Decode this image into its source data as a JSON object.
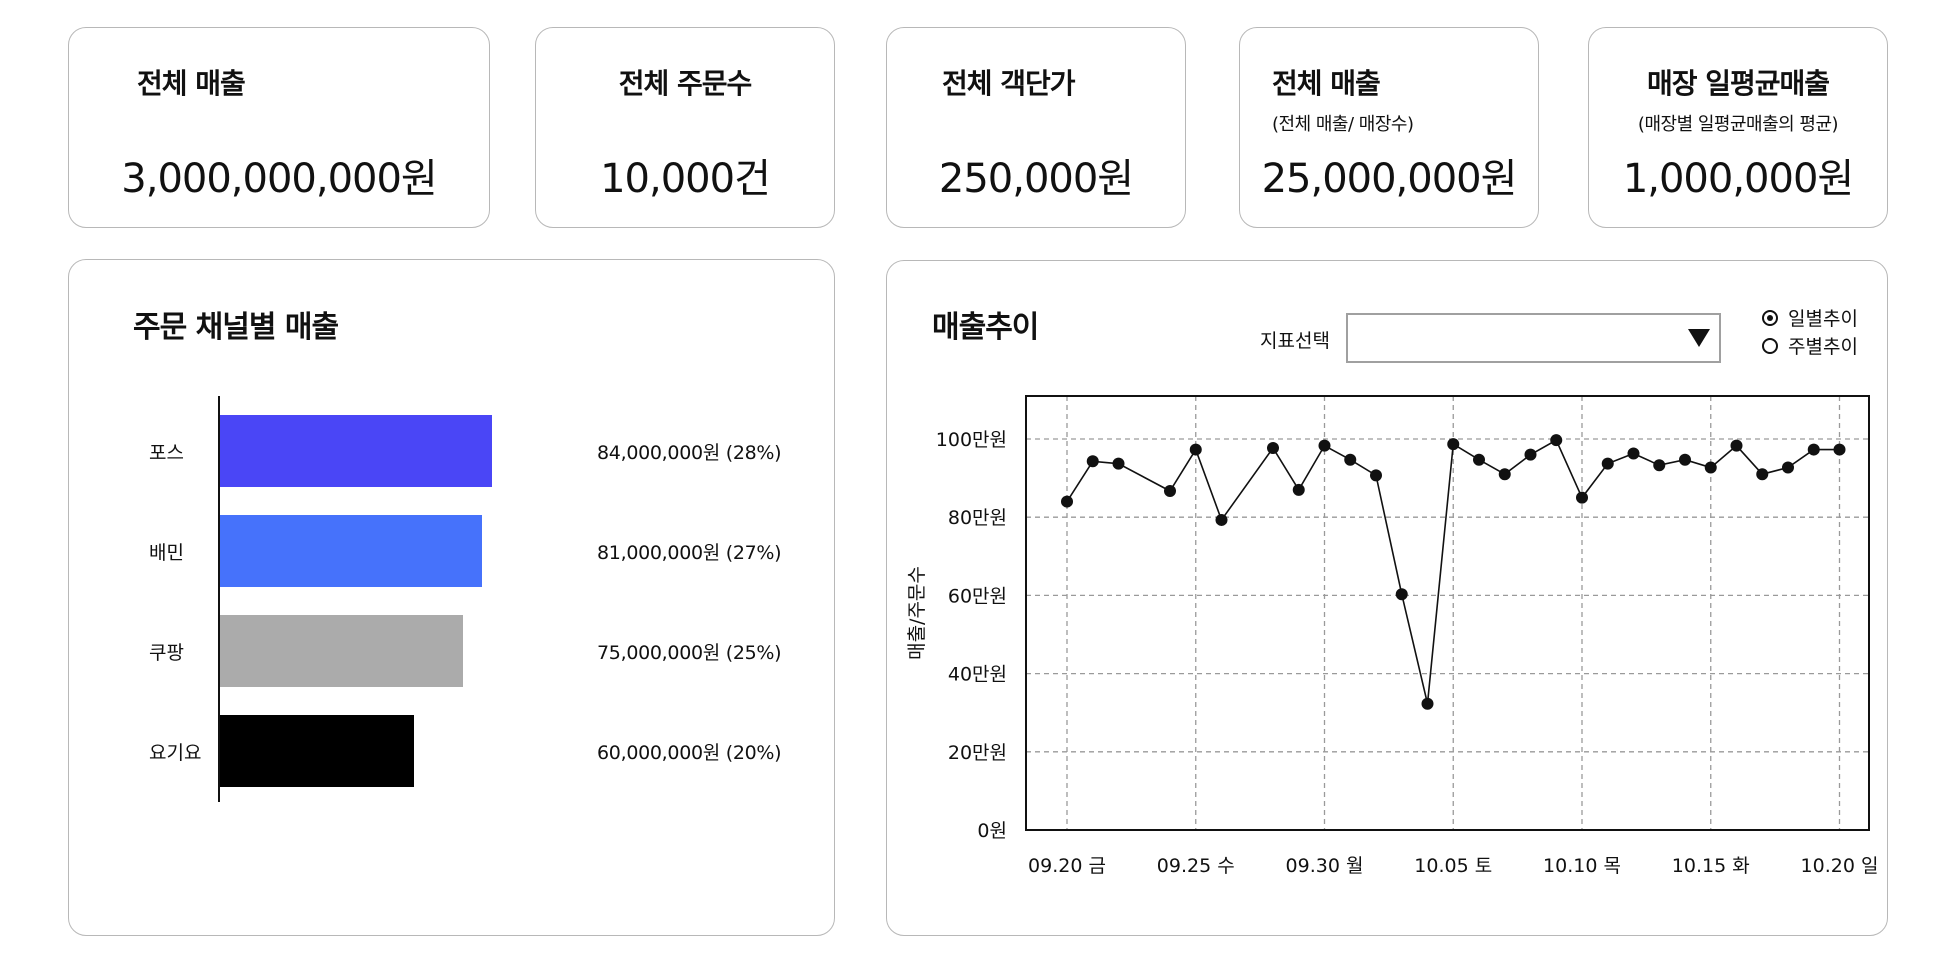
{
  "kpis": [
    {
      "title": "전체 매출",
      "subtitle": "",
      "value": "3,000,000,000원"
    },
    {
      "title": "전체 주문수",
      "subtitle": "",
      "value": "10,000건"
    },
    {
      "title": "전체 객단가",
      "subtitle": "",
      "value": "250,000원"
    },
    {
      "title": "전체 매출",
      "subtitle": "(전체 매출/ 매장수)",
      "value": "25,000,000원"
    },
    {
      "title": "매장 일평균매출",
      "subtitle": "(매장별 일평균매출의 평균)",
      "value": "1,000,000원"
    }
  ],
  "channel_panel": {
    "title": "주문 채널별 매출",
    "items": [
      {
        "label": "포스",
        "value_text": "84,000,000원 (28%)",
        "color": "#4a46f6"
      },
      {
        "label": "배민",
        "value_text": "81,000,000원 (27%)",
        "color": "#4672fb"
      },
      {
        "label": "쿠팡",
        "value_text": "75,000,000원 (25%)",
        "color": "#ababab"
      },
      {
        "label": "요기요",
        "value_text": "60,000,000원 (20%)",
        "color": "#000000"
      }
    ]
  },
  "trend_panel": {
    "title": "매출추이",
    "select_label": "지표선택",
    "select_value": "",
    "dropdown_icon": "triangle-down-icon",
    "radio_daily": "일별추이",
    "radio_weekly": "주별추이",
    "daily_checked": true,
    "weekly_checked": false
  },
  "chart_data": [
    {
      "type": "bar",
      "orientation": "horizontal",
      "title": "주문 채널별 매출",
      "categories": [
        "포스",
        "배민",
        "쿠팡",
        "요기요"
      ],
      "values": [
        84000000,
        81000000,
        75000000,
        60000000
      ],
      "percentages": [
        28,
        27,
        25,
        20
      ]
    },
    {
      "type": "line",
      "title": "매출추이",
      "ylabel": "매출/주문수",
      "xlabel": "",
      "grid": true,
      "ylim": [
        0,
        1110000
      ],
      "yticks": [
        0,
        200000,
        400000,
        600000,
        800000,
        1000000
      ],
      "ytick_labels": [
        "0원",
        "20만원",
        "40만원",
        "60만원",
        "80만원",
        "100만원"
      ],
      "xtick_labels": [
        "09.20 금",
        "09.25 수",
        "09.30 월",
        "10.05 토",
        "10.10 목",
        "10.15 화",
        "10.20 일"
      ],
      "x": [
        "09.20",
        "09.21",
        "09.22",
        "09.24",
        "09.25",
        "09.26",
        "09.28",
        "09.29",
        "09.30",
        "10.01",
        "10.02",
        "10.03",
        "10.04",
        "10.05",
        "10.06",
        "10.07",
        "10.08",
        "10.09",
        "10.10",
        "10.11",
        "10.12",
        "10.13",
        "10.14",
        "10.15",
        "10.16",
        "10.17",
        "10.18",
        "10.19",
        "10.20"
      ],
      "values": [
        840000,
        943000,
        937000,
        867000,
        973000,
        793000,
        977000,
        870000,
        983000,
        947000,
        907000,
        603000,
        323000,
        987000,
        947000,
        910000,
        960000,
        997000,
        850000,
        937000,
        963000,
        933000,
        947000,
        927000,
        983000,
        910000,
        927000,
        973000,
        973000
      ]
    }
  ]
}
